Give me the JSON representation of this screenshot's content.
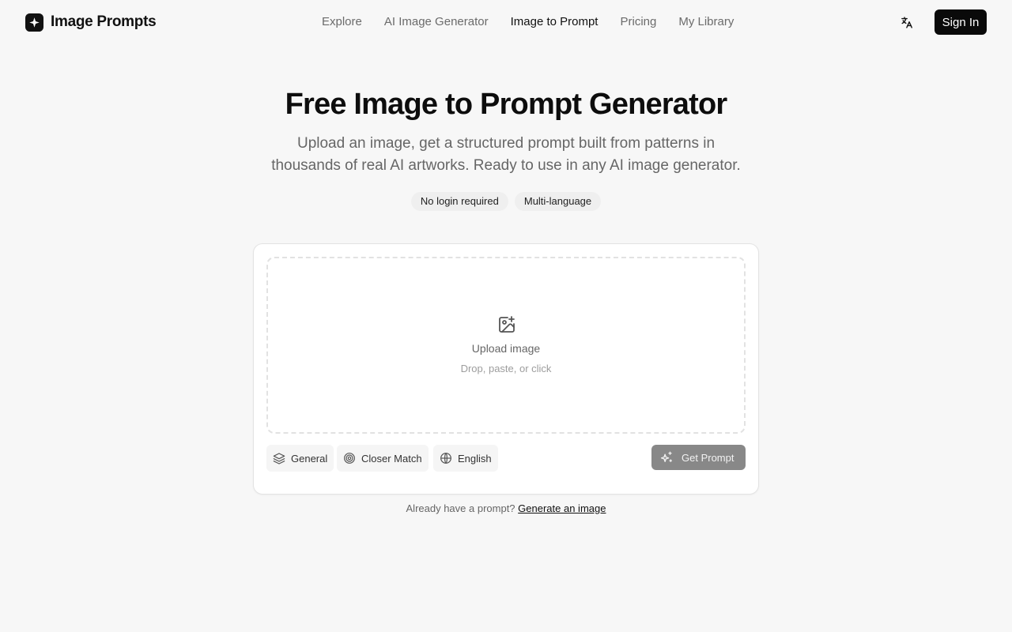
{
  "brand": {
    "name": "Image Prompts",
    "icon": "logo-icon"
  },
  "nav": {
    "items": [
      {
        "label": "Explore",
        "active": false
      },
      {
        "label": "AI Image Generator",
        "active": false
      },
      {
        "label": "Image to Prompt",
        "active": true
      },
      {
        "label": "Pricing",
        "active": false
      },
      {
        "label": "My Library",
        "active": false
      }
    ]
  },
  "header": {
    "language_icon": "translate-icon",
    "signin_label": "Sign In"
  },
  "hero": {
    "title": "Free Image to Prompt Generator",
    "subtitle": "Upload an image, get a structured prompt built from patterns in thousands of real AI artworks. Ready to use in any AI image generator.",
    "chips": [
      "No login required",
      "Multi-language"
    ]
  },
  "uploader": {
    "icon": "image-plus-icon",
    "title": "Upload image",
    "hint": "Drop, paste, or click"
  },
  "options": {
    "style": {
      "label": "General",
      "icon": "layers-icon"
    },
    "mode": {
      "label": "Closer Match",
      "icon": "target-icon"
    },
    "language": {
      "label": "English",
      "icon": "globe-icon"
    }
  },
  "submit": {
    "label": "Get Prompt",
    "icon": "sparkles-icon",
    "enabled": false
  },
  "footer": {
    "text": "Already have a prompt?",
    "link": "Generate an image"
  },
  "colors": {
    "background": "#f7f7f7",
    "primary": "#0a0a0a",
    "disabled_button": "#888888"
  }
}
